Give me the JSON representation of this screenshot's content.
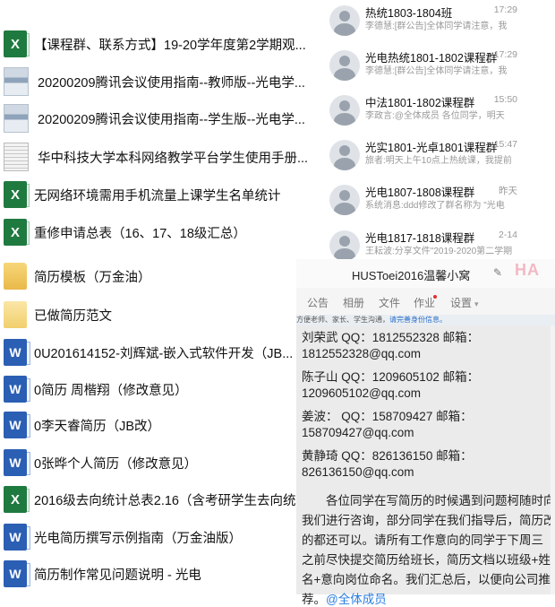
{
  "files": [
    {
      "type": "excel",
      "name": "【课程群、联系方式】19-20学年度第2学期观..."
    },
    {
      "type": "pdf",
      "name": "20200209腾讯会议使用指南--教师版--光电学..."
    },
    {
      "type": "pdf",
      "name": "20200209腾讯会议使用指南--学生版--光电学..."
    },
    {
      "type": "pdf",
      "name": "华中科技大学本科网络教学平台学生使用手册..."
    },
    {
      "type": "excel",
      "name": "无网络环境需用手机流量上课学生名单统计"
    },
    {
      "type": "excel",
      "name": "重修申请总表（16、17、18级汇总）"
    },
    {
      "type": "folder",
      "name": "简历模板（万金油）"
    },
    {
      "type": "folder",
      "name": "已做简历范文"
    },
    {
      "type": "word",
      "name": "0U201614152-刘辉斌-嵌入式软件开发（JB..."
    },
    {
      "type": "word",
      "name": "0简历 周楷翔（修改意见）"
    },
    {
      "type": "word",
      "name": "0李天睿简历（JB改）"
    },
    {
      "type": "word",
      "name": "0张晔个人简历（修改意见）"
    },
    {
      "type": "excel",
      "name": "2016级去向统计总表2.16（含考研学生去向统..."
    },
    {
      "type": "word",
      "name": "光电简历撰写示例指南（万金油版）"
    },
    {
      "type": "word",
      "name": "简历制作常见问题说明 - 光电"
    }
  ],
  "chats": [
    {
      "name": "热统1803-1804班",
      "time": "17:29",
      "preview": "李德慧:[群公告]全体同学请注意，我"
    },
    {
      "name": "光电热统1801-1802课程群",
      "time": "17:29",
      "preview": "李德慧:[群公告]全体同学请注意，我"
    },
    {
      "name": "中法1801-1802课程群",
      "time": "15:50",
      "preview": "李政言:@全体成员 各位同学，明天"
    },
    {
      "name": "光实1801-光卓1801课程群",
      "time": "15:47",
      "preview": "旅者:明天上午10点上热统课，我提前"
    },
    {
      "name": "光电1807-1808课程群",
      "time": "昨天",
      "preview": "系统消息:ddd修改了群名称为 \"光电"
    },
    {
      "name": "光电1817-1818课程群",
      "time": "2-14",
      "preview": "王耘波:分享文件\"2019-2020第二学期"
    }
  ],
  "group": {
    "title": "HUSToei2016温馨小窝",
    "tabs": [
      "公告",
      "相册",
      "文件",
      "作业",
      "设置"
    ],
    "notice_text": "方便老师、家长、学生沟通，",
    "notice_link": "请完善身份信息。",
    "lines": [
      "刘荣武 QQ：1812552328 邮箱：",
      "1812552328@qq.com",
      "陈子山 QQ：1209605102 邮箱：",
      "1209605102@qq.com",
      "姜波： QQ：158709427  邮箱：",
      "158709427@qq.com",
      "黄静琦 QQ：826136150   邮箱：",
      "826136150@qq.com",
      "　　各位同学在写简历的时候遇到问题柯随时向",
      "我们进行咨询，部分同学在我们指导后，简历改",
      "的都还可以。请所有工作意向的同学于下周三",
      "之前尽快提交简历给班长，简历文档以班级+姓",
      "名+意向岗位命名。我们汇总后，以便向公司推",
      "荐。"
    ],
    "mention": "@全体成员"
  }
}
